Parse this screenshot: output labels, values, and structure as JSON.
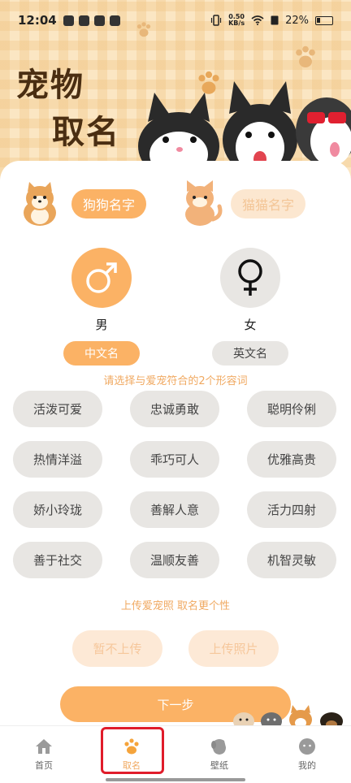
{
  "status_bar": {
    "time": "12:04",
    "speed_value": "0.50",
    "speed_unit": "KB/s",
    "battery": "22%"
  },
  "header": {
    "title_line1": "宠物",
    "title_line2": "取名"
  },
  "pet_tabs": {
    "dog": "狗狗名字",
    "cat": "猫猫名字"
  },
  "gender": {
    "male": "男",
    "female": "女"
  },
  "name_lang": {
    "chinese": "中文名",
    "english": "英文名"
  },
  "adjective_hint": "请选择与爱宠符合的2个形容词",
  "adjectives": [
    "活泼可爱",
    "忠诚勇敢",
    "聪明伶俐",
    "热情洋溢",
    "乖巧可人",
    "优雅高贵",
    "娇小玲珑",
    "善解人意",
    "活力四射",
    "善于社交",
    "温顺友善",
    "机智灵敏"
  ],
  "upload_hint": "上传爱宠照 取名更个性",
  "upload": {
    "skip": "暂不上传",
    "upload": "上传照片"
  },
  "next_label": "下一步",
  "nav": {
    "home": "首页",
    "naming": "取名",
    "wallpaper": "壁纸",
    "mine": "我的"
  },
  "colors": {
    "accent": "#fbb265",
    "accent_text": "#f0a961",
    "chip_bg": "#e8e6e3",
    "highlight": "#e01c2a"
  }
}
